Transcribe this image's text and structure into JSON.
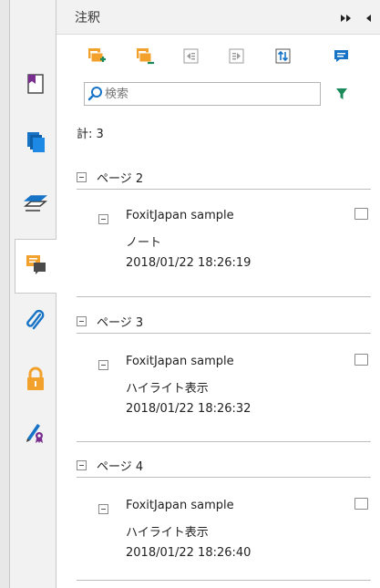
{
  "panel": {
    "title": "注釈"
  },
  "search": {
    "value": "",
    "placeholder": "検索"
  },
  "count_text": "計: 3",
  "groups": [
    {
      "page_label": "ページ 2",
      "comment": {
        "author": "FoxitJapan sample",
        "type": "ノート",
        "date": "2018/01/22 18:26:19"
      }
    },
    {
      "page_label": "ページ 3",
      "comment": {
        "author": "FoxitJapan sample",
        "type": "ハイライト表示",
        "date": "2018/01/22 18:26:32"
      }
    },
    {
      "page_label": "ページ 4",
      "comment": {
        "author": "FoxitJapan sample",
        "type": "ハイライト表示",
        "date": "2018/01/22 18:26:40"
      }
    }
  ],
  "colors": {
    "accent_orange": "#f2a22c",
    "accent_blue": "#1673c6",
    "accent_green": "#1a8a5a",
    "icon_gray": "#9b9b9b"
  },
  "icons": {
    "tabs": [
      "page-thumbnail-icon",
      "pages-icon",
      "layers-icon",
      "comments-icon",
      "attachment-icon",
      "security-lock-icon",
      "signature-icon"
    ],
    "toolbar": [
      "import-comments-icon",
      "export-comments-icon",
      "collapse-all-icon",
      "expand-all-icon",
      "sort-icon",
      "comment-bubble-icon"
    ],
    "header": [
      "fast-forward-icon",
      "collapse-panel-icon"
    ],
    "search": "search-icon",
    "filter": "filter-icon"
  }
}
